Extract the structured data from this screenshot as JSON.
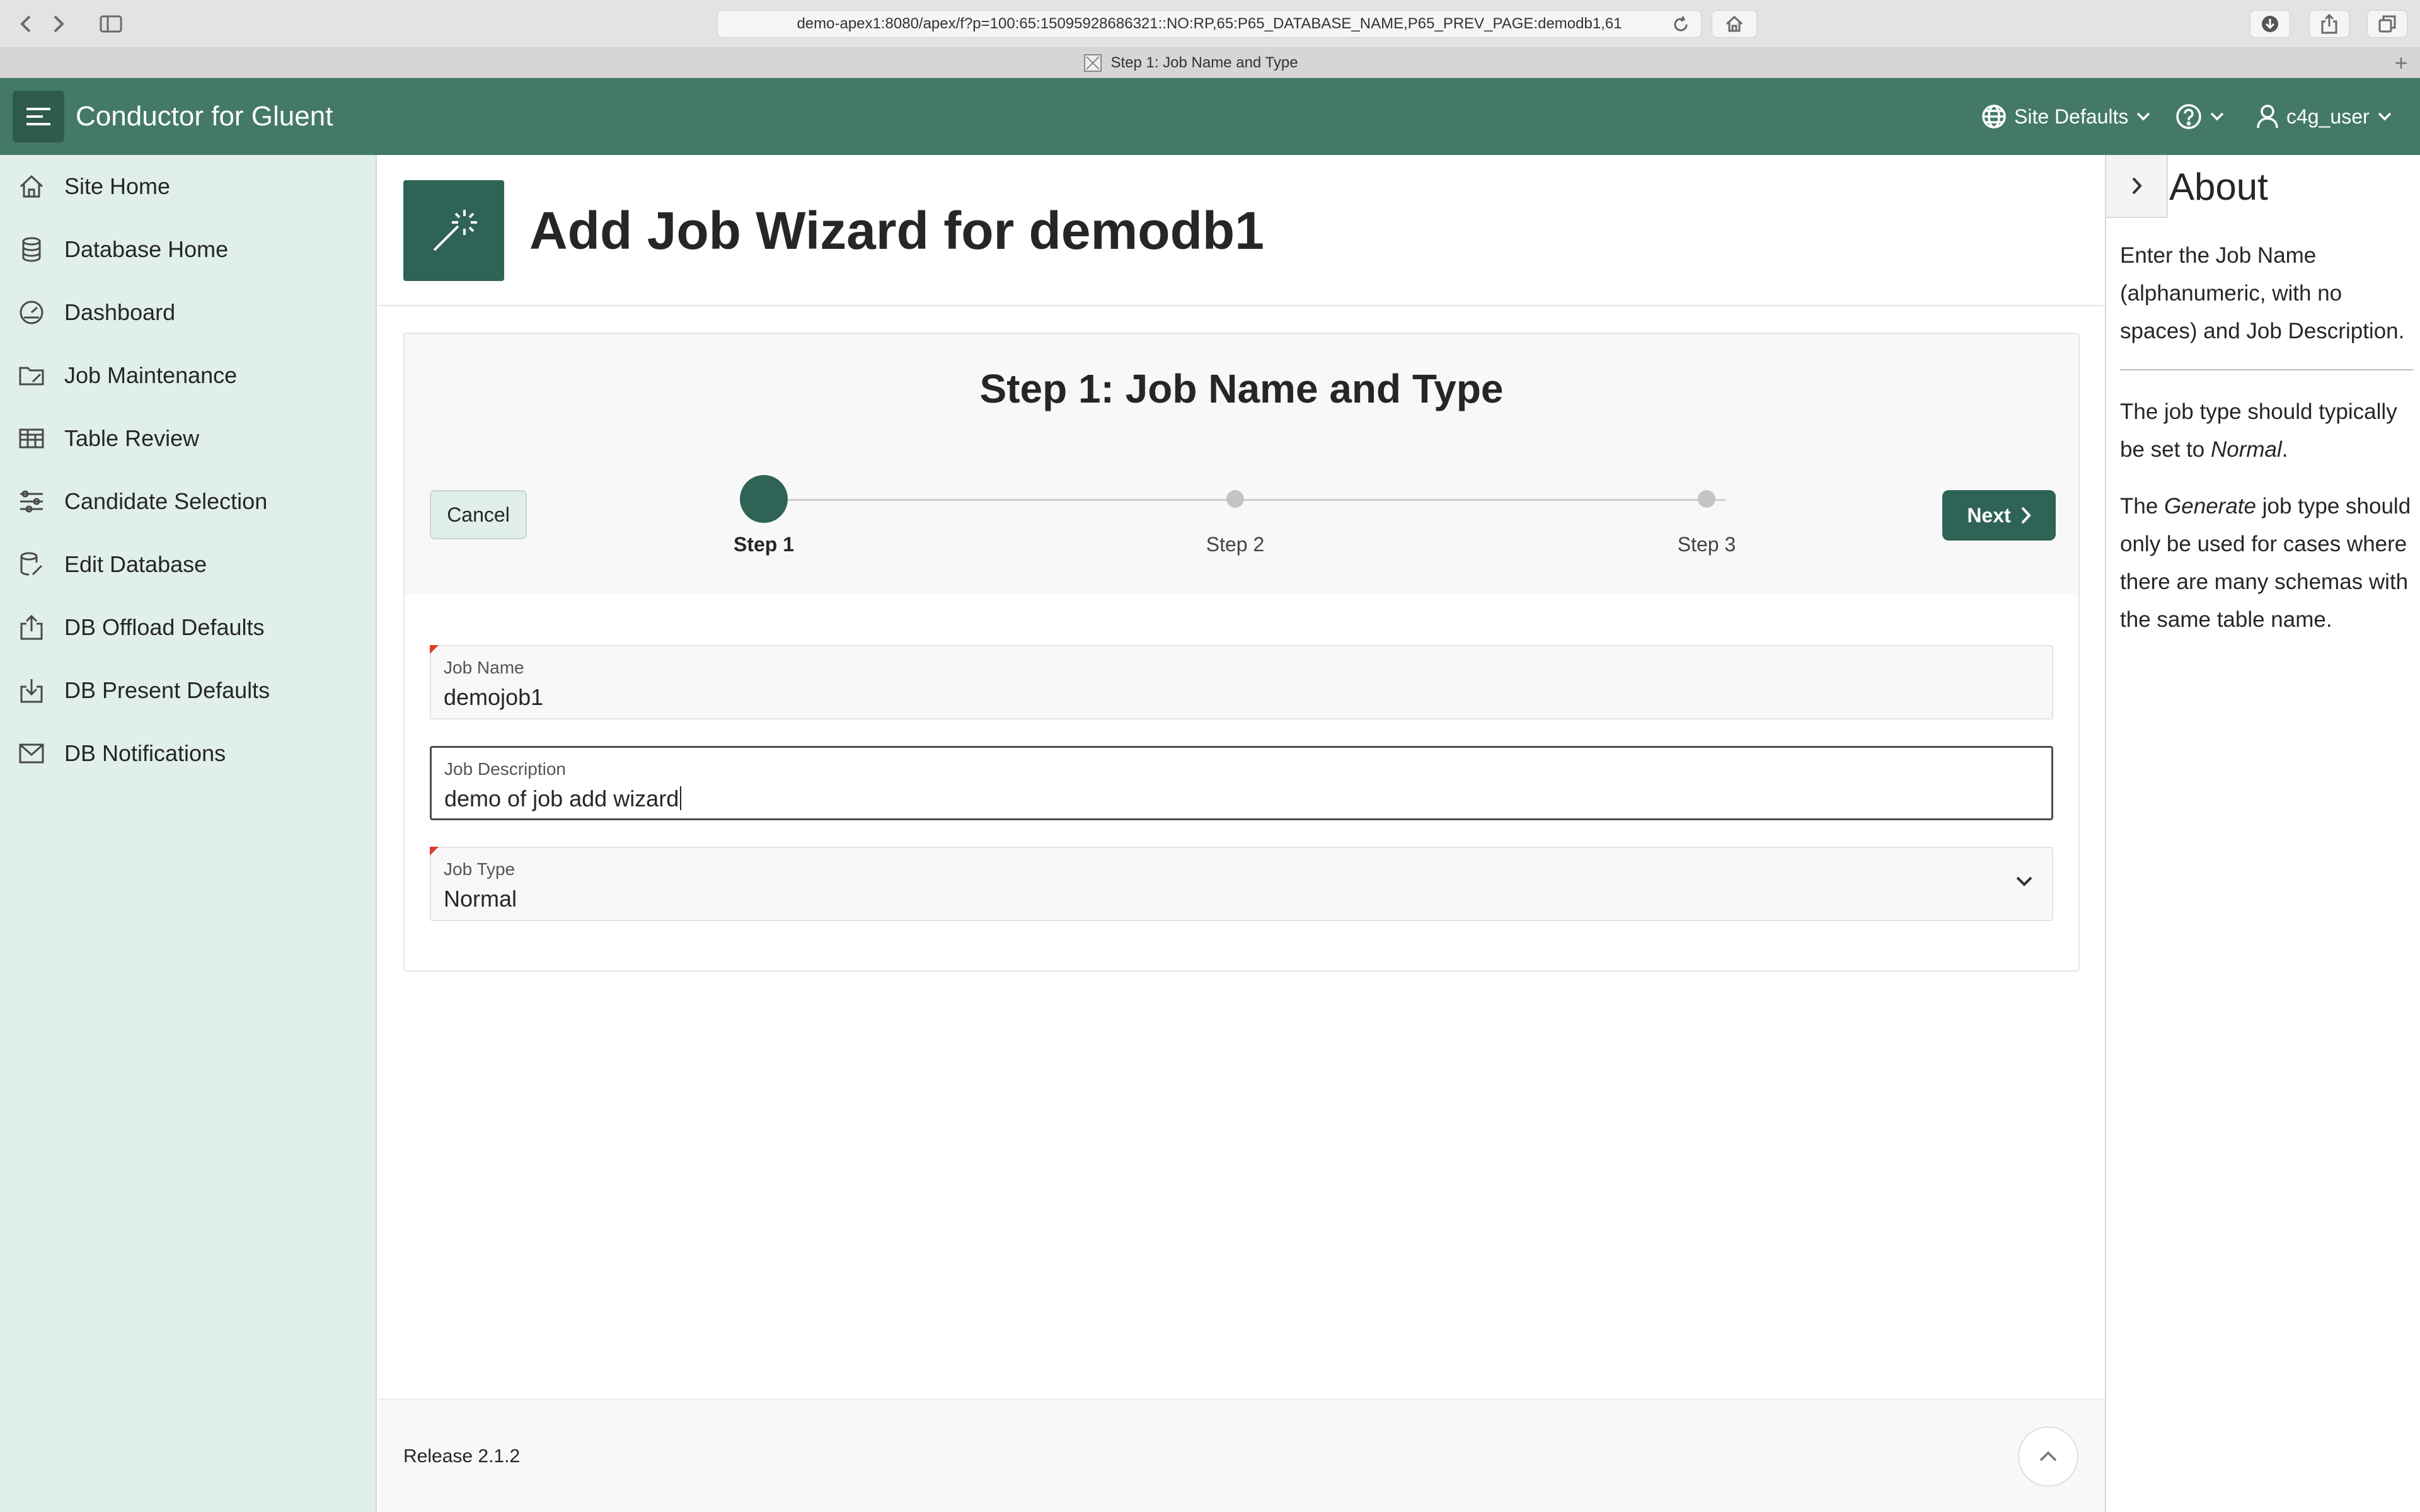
{
  "browser": {
    "url": "demo-apex1:8080/apex/f?p=100:65:15095928686321::NO:RP,65:P65_DATABASE_NAME,P65_PREV_PAGE:demodb1,61",
    "tab_title": "Step 1: Job Name and Type",
    "icons": [
      "back-icon",
      "forward-icon",
      "sidebar-icon",
      "reload-icon",
      "home-icon",
      "download-icon",
      "share-icon",
      "tabs-icon",
      "plus-icon"
    ]
  },
  "header": {
    "app_title": "Conductor for Gluent",
    "site_defaults": "Site Defaults",
    "user": "c4g_user"
  },
  "nav": {
    "items": [
      {
        "label": "Site Home",
        "icon": "home-icon"
      },
      {
        "label": "Database Home",
        "icon": "database-icon"
      },
      {
        "label": "Dashboard",
        "icon": "dashboard-icon"
      },
      {
        "label": "Job Maintenance",
        "icon": "folder-edit-icon"
      },
      {
        "label": "Table Review",
        "icon": "table-icon"
      },
      {
        "label": "Candidate Selection",
        "icon": "sliders-icon"
      },
      {
        "label": "Edit Database",
        "icon": "database-edit-icon"
      },
      {
        "label": "DB Offload Defaults",
        "icon": "upload-icon"
      },
      {
        "label": "DB Present Defaults",
        "icon": "download-icon"
      },
      {
        "label": "DB Notifications",
        "icon": "mail-icon"
      }
    ]
  },
  "page": {
    "title": "Add Job Wizard for demodb1",
    "icon": "magic-wand-icon"
  },
  "wizard": {
    "title": "Step 1: Job Name and Type",
    "cancel_label": "Cancel",
    "next_label": "Next",
    "steps": [
      {
        "label": "Step 1",
        "current": true
      },
      {
        "label": "Step 2",
        "current": false
      },
      {
        "label": "Step 3",
        "current": false
      }
    ]
  },
  "form": {
    "job_name": {
      "label": "Job Name",
      "value": "demojob1",
      "required": true
    },
    "job_description": {
      "label": "Job Description",
      "value": "demo of job add wizard",
      "required": false
    },
    "job_type": {
      "label": "Job Type",
      "value": "Normal",
      "required": true
    }
  },
  "footer": {
    "release": "Release 2.1.2"
  },
  "about": {
    "title": "About",
    "para1": "Enter the Job Name (alphanumeric, with no spaces) and Job Description.",
    "para2_pre": "The job type should typically be set to ",
    "para2_em": "Normal",
    "para2_post": ".",
    "para3_pre": "The ",
    "para3_em": "Generate",
    "para3_post": " job type should only be used for cases where there are many schemas with the same table name."
  }
}
